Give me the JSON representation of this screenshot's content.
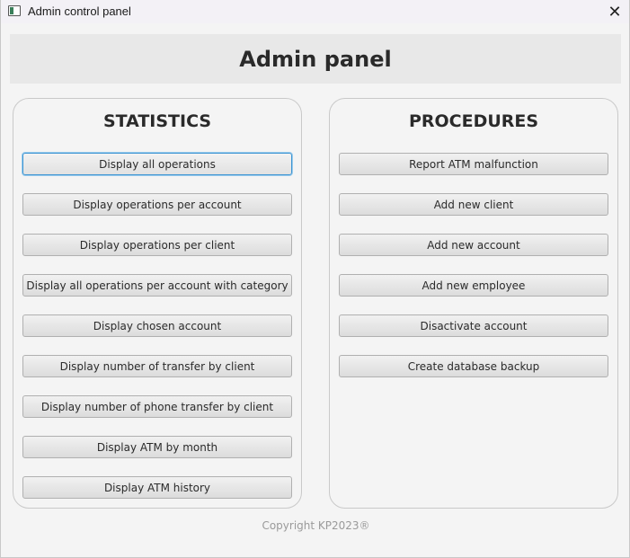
{
  "window": {
    "title": "Admin control panel",
    "close_glyph": "✕"
  },
  "header": {
    "title": "Admin panel"
  },
  "statistics": {
    "title": "STATISTICS",
    "buttons": [
      "Display all operations",
      "Display operations per account",
      "Display operations per client",
      "Display all operations per account with category",
      "Display chosen account",
      "Display number of transfer by client",
      "Display number of phone transfer by client",
      "Display ATM by month",
      "Display ATM history"
    ]
  },
  "procedures": {
    "title": "PROCEDURES",
    "buttons": [
      "Report ATM malfunction",
      "Add new client",
      "Add new account",
      "Add new employee",
      "Disactivate account",
      "Create database backup"
    ]
  },
  "footer": {
    "copyright": "Copyright KP2023®"
  },
  "colors": {
    "focus_border": "#3d95d3",
    "header_bg": "#e8e8e8"
  }
}
